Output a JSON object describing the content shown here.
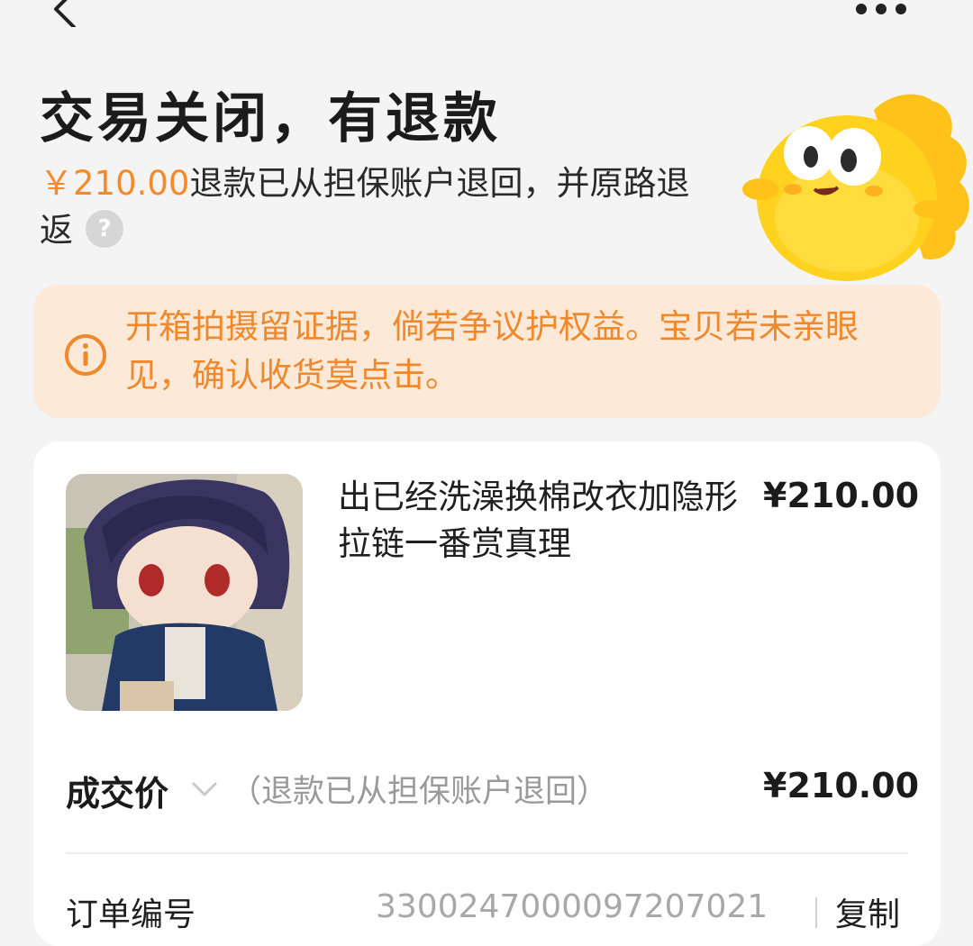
{
  "status": {
    "title": "交易关闭，有退款",
    "amount": "￥210.00",
    "desc": "退款已从担保账户退回，并原路退返"
  },
  "notice": {
    "text": "开箱拍摄留证据，倘若争议护权益。宝贝若未亲眼见，确认收货莫点击。"
  },
  "item": {
    "title": "出已经洗澡换棉改衣加隐形拉链一番赏真理",
    "price": "¥210.00"
  },
  "deal": {
    "label": "成交价",
    "note": "（退款已从担保账户退回）",
    "price": "¥210.00"
  },
  "order": {
    "label": "订单编号",
    "number": "3300247000097207021",
    "copy_label": "复制"
  },
  "icons": {
    "back": "back-arrow-icon",
    "more": "more-icon",
    "help": "help-icon",
    "info": "info-icon",
    "chevron": "chevron-down-icon"
  },
  "colors": {
    "accent": "#f58a2a",
    "notice_bg": "#fde9d7"
  }
}
